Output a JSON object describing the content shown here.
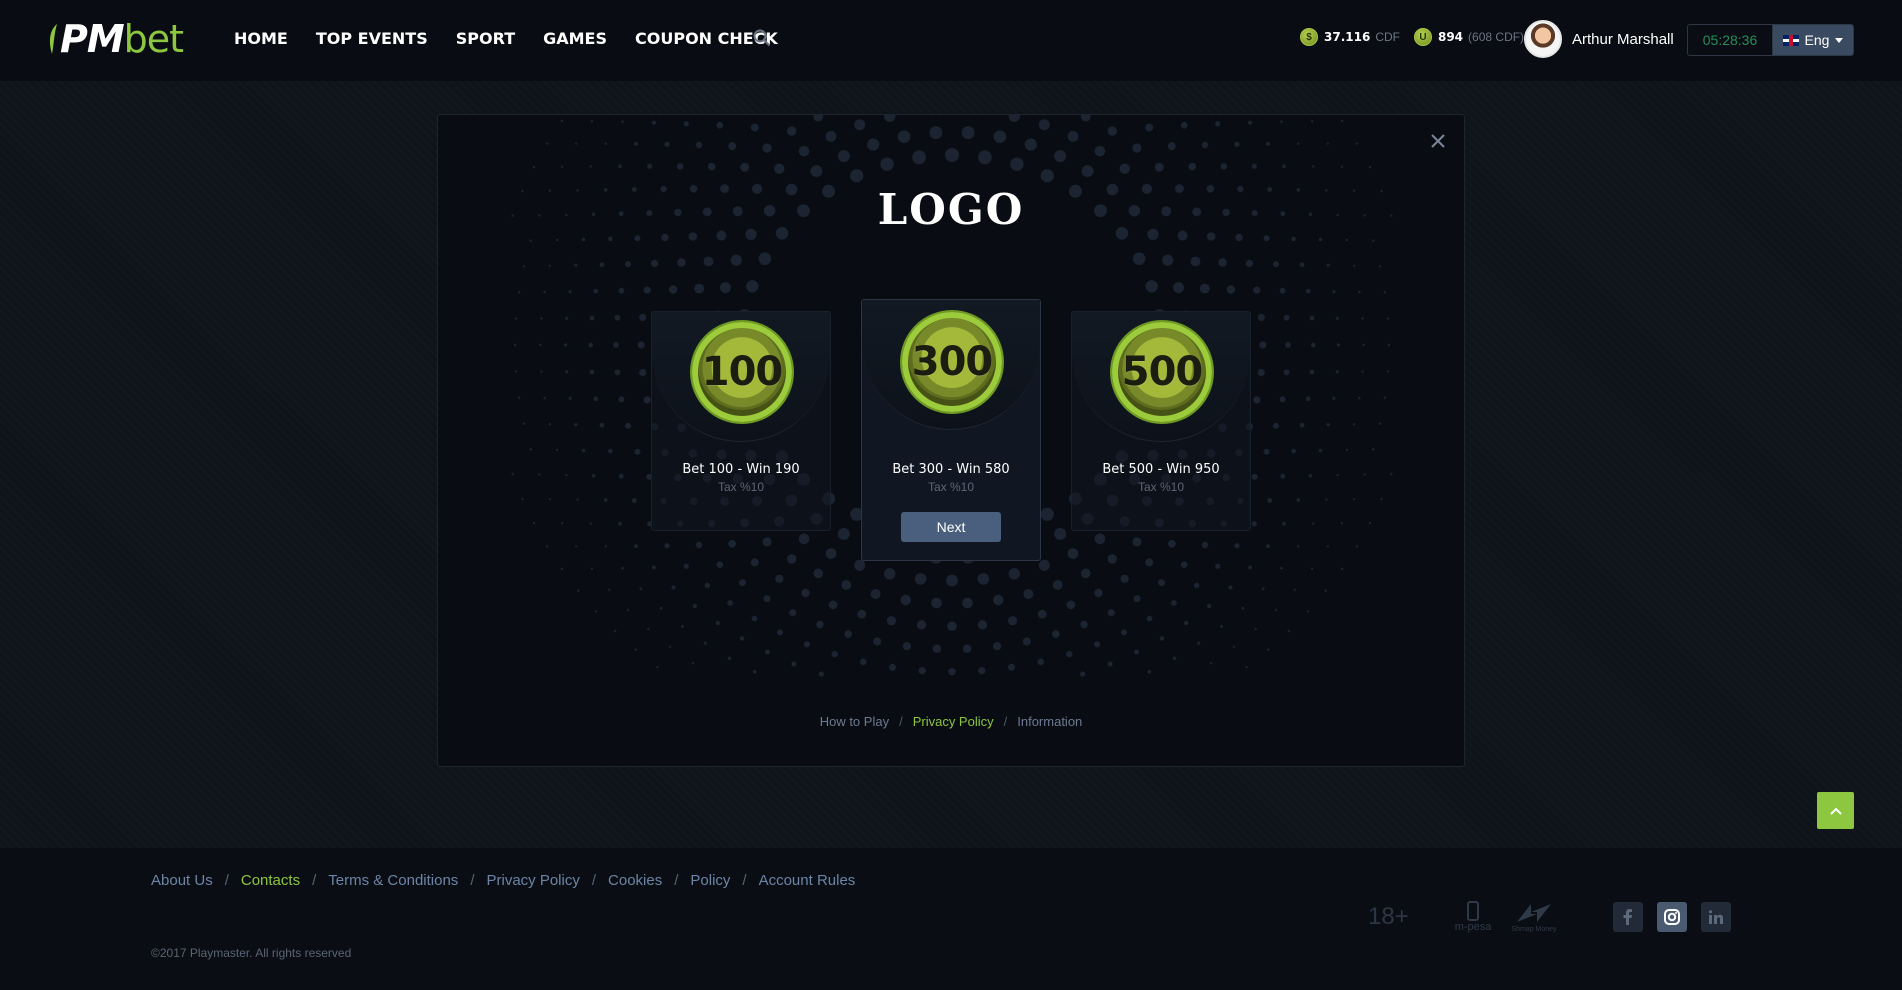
{
  "header": {
    "logo": {
      "pm": "PM",
      "bet": "bet"
    },
    "nav": [
      "HOME",
      "TOP EVENTS",
      "SPORT",
      "GAMES",
      "COUPON CHECK"
    ],
    "balance_main": {
      "value": "37.116",
      "currency": "CDF"
    },
    "balance_bonus": {
      "value": "894",
      "currency": "(608 CDF)"
    },
    "user_name": "Arthur Marshall",
    "clock": "05:28:36",
    "language": "Eng"
  },
  "modal": {
    "logo": "LOGO",
    "cards": [
      {
        "chip": "100",
        "title": "Bet 100 - Win 190",
        "tax": "Tax %10"
      },
      {
        "chip": "300",
        "title": "Bet 300 - Win 580",
        "tax": "Tax %10"
      },
      {
        "chip": "500",
        "title": "Bet 500 - Win 950",
        "tax": "Tax %10"
      }
    ],
    "next_label": "Next",
    "links": [
      "How to Play",
      "Privacy Policy",
      "Information"
    ],
    "separator": "/"
  },
  "footer": {
    "links": [
      "About Us",
      "Contacts",
      "Terms & Conditions",
      "Privacy Policy",
      "Cookies",
      "Policy",
      "Account Rules"
    ],
    "copyright": "©2017 Playmaster. All rights reserved",
    "age": "18+",
    "mpesa": "m-pesa",
    "smoney": "Shmap Money"
  },
  "colors": {
    "accent": "#8dc63f",
    "background": "#0f141b",
    "button": "#4a5f7d"
  },
  "icons": [
    "search-icon",
    "coin-icon",
    "bonus-coin-icon",
    "close-icon",
    "chevron-up-icon",
    "facebook-icon",
    "instagram-icon",
    "linkedin-icon"
  ]
}
